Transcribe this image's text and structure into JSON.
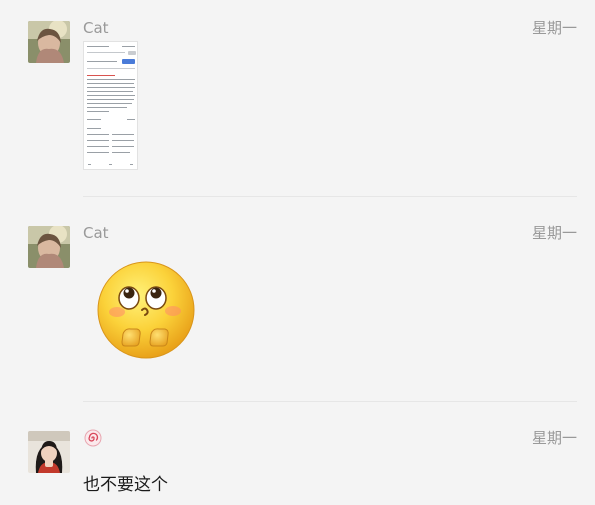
{
  "messages": [
    {
      "sender": "Cat",
      "time": "星期一",
      "content_type": "image"
    },
    {
      "sender": "Cat",
      "time": "星期一",
      "content_type": "sticker",
      "sticker_icon": "eyes-up-pleading-emoji-icon"
    },
    {
      "sender": "",
      "sender_icon": "red-swirl-icon",
      "time": "星期一",
      "text": "也不要这个"
    }
  ],
  "colors": {
    "background": "#f4f4f4",
    "meta_text": "#999999",
    "message_text": "#1a1a1a",
    "divider": "#e6e6e6",
    "swirl": "#d9465a"
  }
}
